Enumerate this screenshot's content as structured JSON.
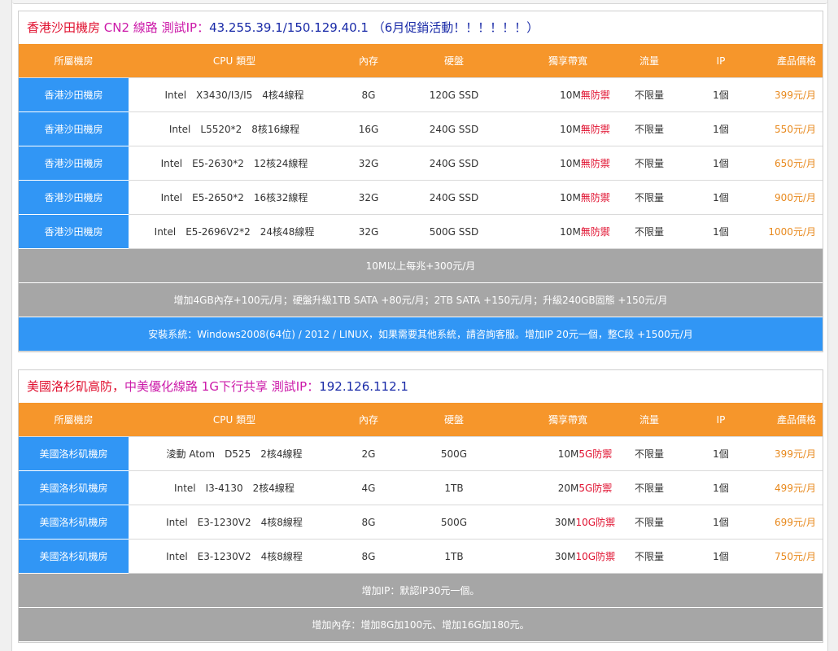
{
  "columns": [
    "所屬機房",
    "CPU 類型",
    "內存",
    "硬盤",
    "獨享帶寬",
    "流量",
    "IP",
    "產品價格"
  ],
  "hk": {
    "title": {
      "part1": "香港沙田機房",
      "part2": "CN2 線路",
      "part3": "測試IP：",
      "part4": "43.255.39.1/150.129.40.1",
      "part5": "（6月促銷活動！！！！！！）"
    },
    "rows": [
      {
        "room": "香港沙田機房",
        "cpu": "Intel　X3430/I3/I5　4核4線程",
        "mem": "8G",
        "disk": "120G SSD",
        "bw": "10M",
        "ddos": "無防禦",
        "traffic": "不限量",
        "ip": "1個",
        "price": "399元/月"
      },
      {
        "room": "香港沙田機房",
        "cpu": "Intel　L5520*2　8核16線程",
        "mem": "16G",
        "disk": "240G SSD",
        "bw": "10M",
        "ddos": "無防禦",
        "traffic": "不限量",
        "ip": "1個",
        "price": "550元/月"
      },
      {
        "room": "香港沙田機房",
        "cpu": "Intel　E5-2630*2　12核24線程",
        "mem": "32G",
        "disk": "240G SSD",
        "bw": "10M",
        "ddos": "無防禦",
        "traffic": "不限量",
        "ip": "1個",
        "price": "650元/月"
      },
      {
        "room": "香港沙田機房",
        "cpu": "Intel　E5-2650*2　16核32線程",
        "mem": "32G",
        "disk": "240G SSD",
        "bw": "10M",
        "ddos": "無防禦",
        "traffic": "不限量",
        "ip": "1個",
        "price": "900元/月"
      },
      {
        "room": "香港沙田機房",
        "cpu": "Intel　E5-2696V2*2　24核48線程",
        "mem": "32G",
        "disk": "500G SSD",
        "bw": "10M",
        "ddos": "無防禦",
        "traffic": "不限量",
        "ip": "1個",
        "price": "1000元/月"
      }
    ],
    "notes": [
      "10M以上每兆+300元/月",
      "增加4GB內存+100元/月；硬盤升級1TB SATA +80元/月；2TB SATA +150元/月；升級240GB固態 +150元/月"
    ],
    "install_note": "安裝系統：Windows2008(64位) / 2012 /  LINUX，如果需要其他系統，請咨詢客服。增加IP 20元一個，整C段 +1500元/月"
  },
  "us": {
    "title": {
      "part1": "美國洛杉矶高防，",
      "part2": "中美優化線路 1G下行共享",
      "part3": "測試IP：",
      "part4": "192.126.112.1"
    },
    "rows": [
      {
        "room": "美國洛杉矶機房",
        "cpu": "淩動 Atom　D525　2核4線程",
        "mem": "2G",
        "disk": "500G",
        "bw": "10M",
        "ddos": "5G防禦",
        "traffic": "不限量",
        "ip": "1個",
        "price": "399元/月"
      },
      {
        "room": "美國洛杉矶機房",
        "cpu": "Intel　I3-4130　2核4線程",
        "mem": "4G",
        "disk": "1TB",
        "bw": "20M",
        "ddos": "5G防禦",
        "traffic": "不限量",
        "ip": "1個",
        "price": "499元/月"
      },
      {
        "room": "美國洛杉矶機房",
        "cpu": "Intel　E3-1230V2　4核8線程",
        "mem": "8G",
        "disk": "500G",
        "bw": "30M",
        "ddos": "10G防禦",
        "traffic": "不限量",
        "ip": "1個",
        "price": "699元/月"
      },
      {
        "room": "美國洛杉矶機房",
        "cpu": "Intel　E3-1230V2　4核8線程",
        "mem": "8G",
        "disk": "1TB",
        "bw": "30M",
        "ddos": "10G防禦",
        "traffic": "不限量",
        "ip": "1個",
        "price": "750元/月"
      }
    ],
    "notes": [
      "增加IP：默認IP30元一個。",
      "增加內存：增加8G加100元、增加16G加180元。"
    ]
  },
  "colors": {
    "header_orange": "#f6962b",
    "room_blue": "#3196f5",
    "note_gray": "#a6a6a6",
    "price_orange": "#e8891d",
    "ddos_red": "#e0102f"
  }
}
